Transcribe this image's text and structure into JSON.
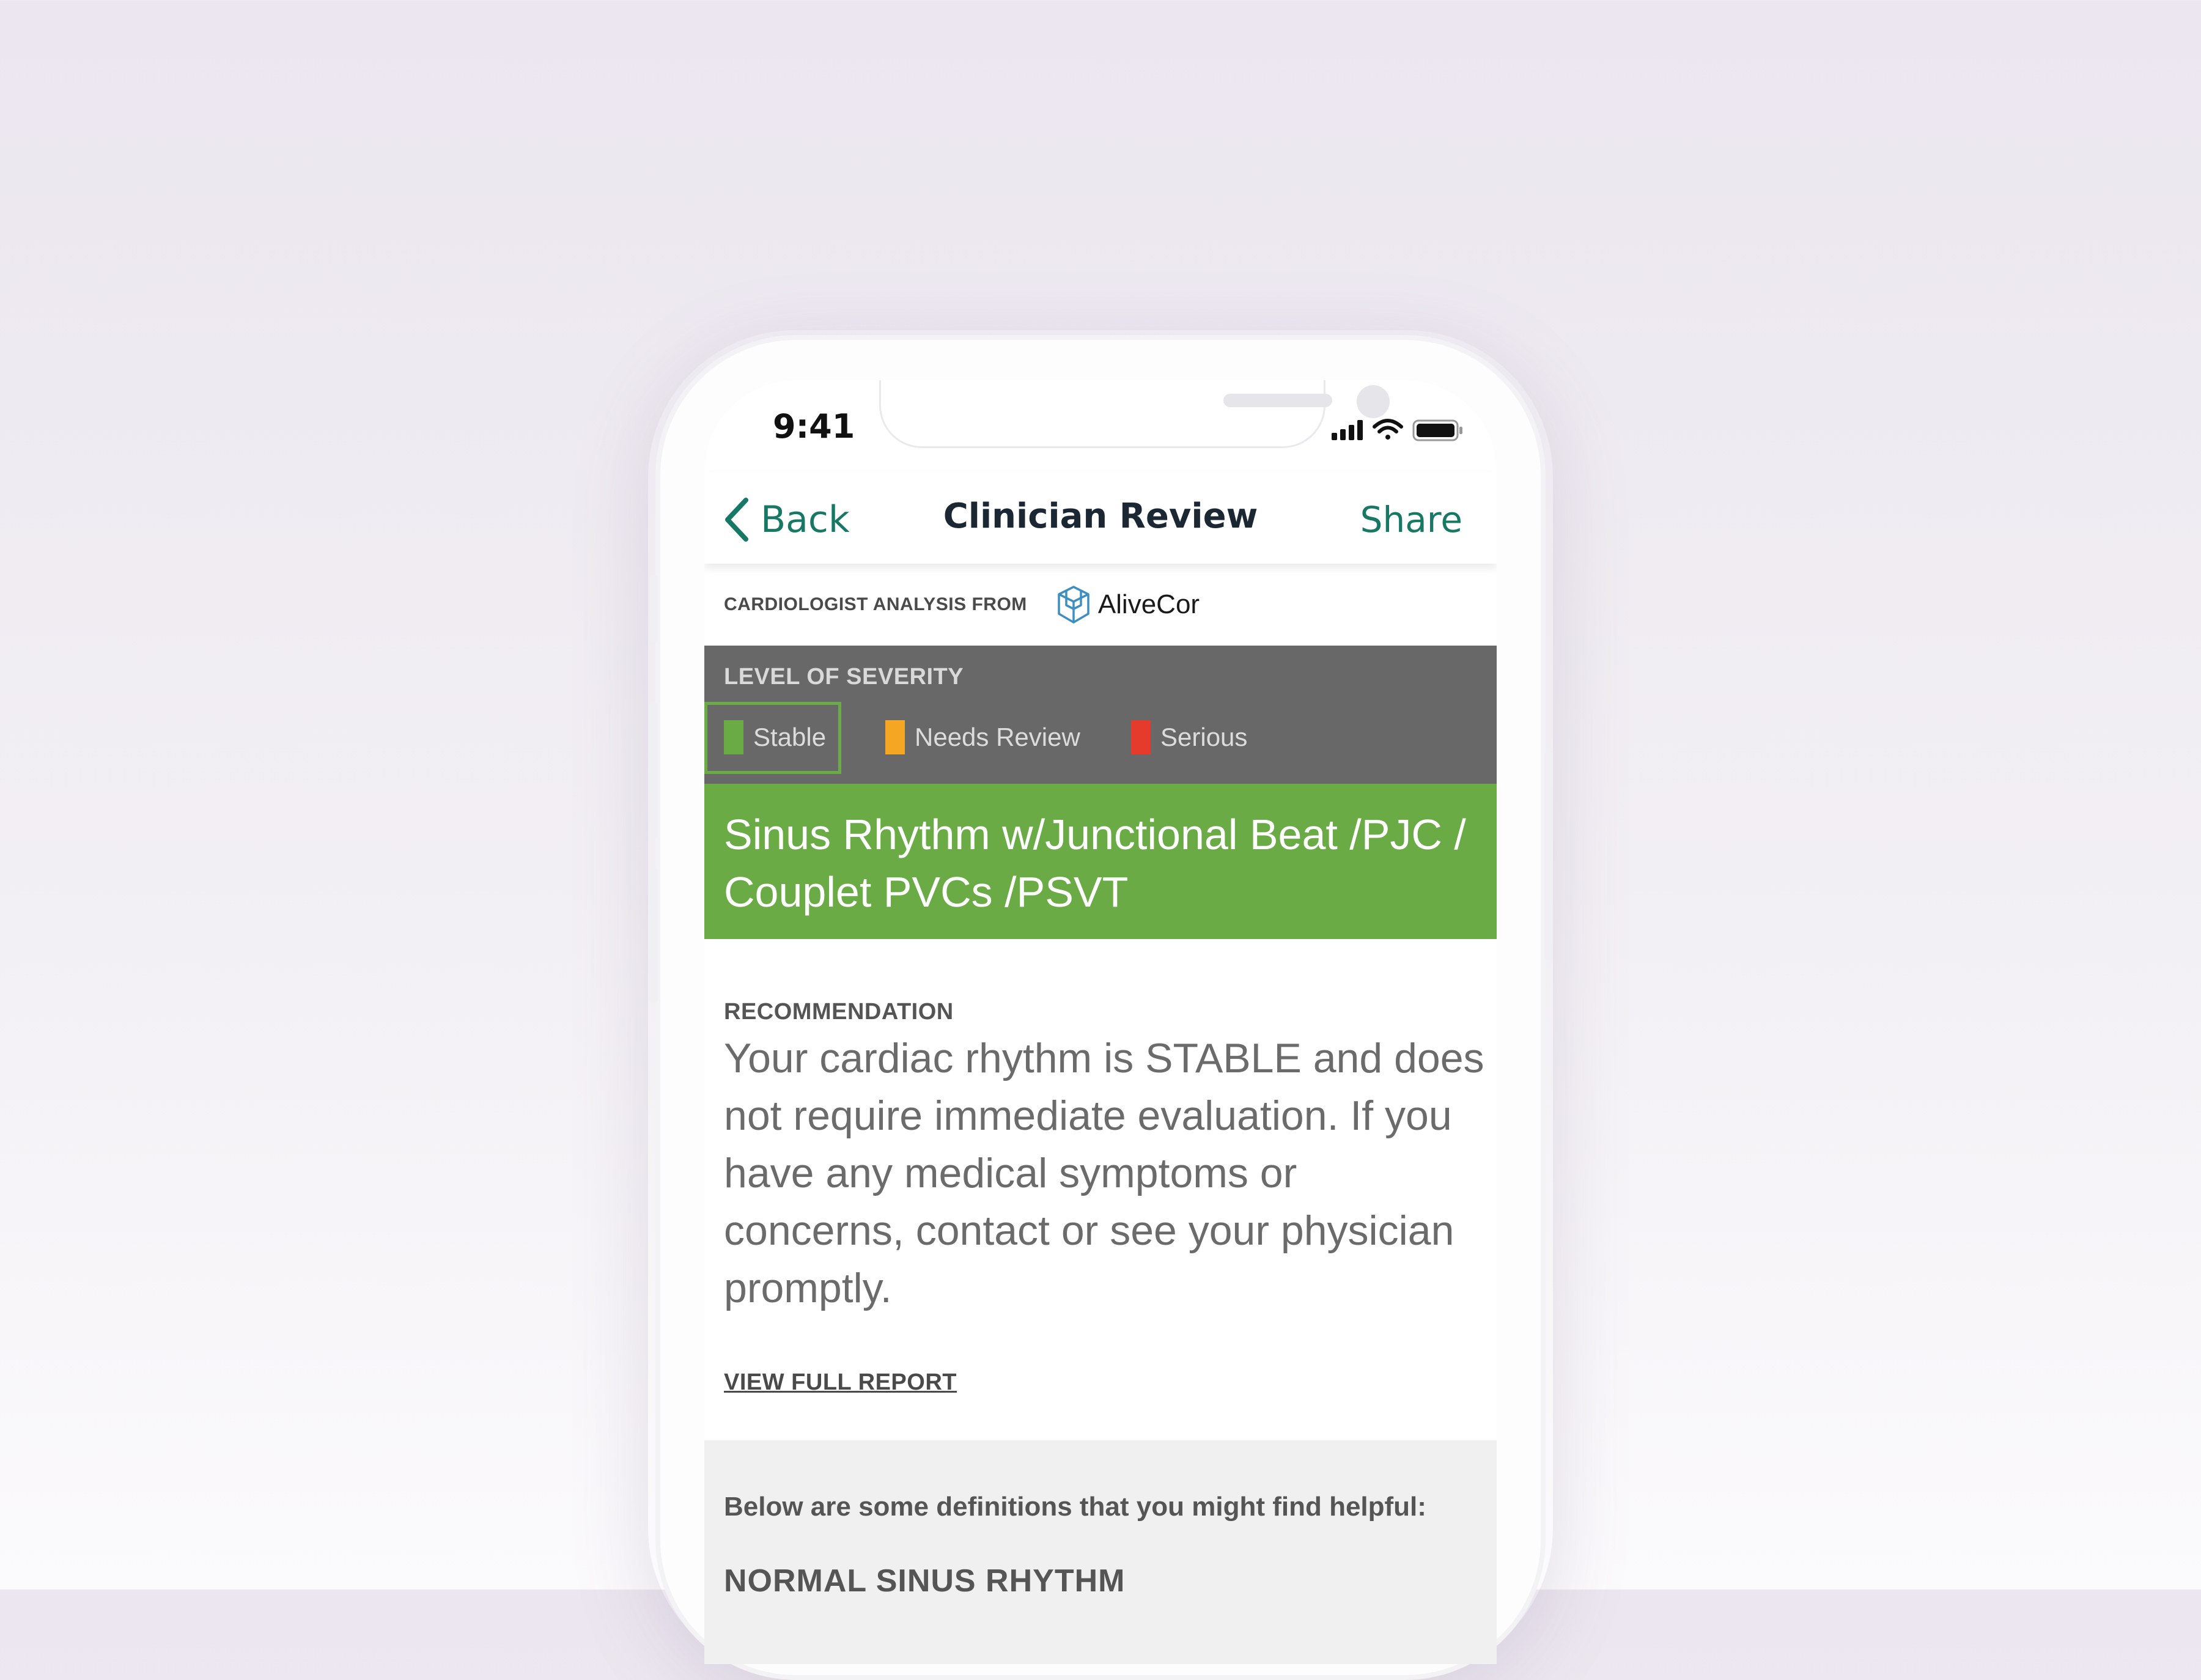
{
  "status_bar": {
    "time": "9:41"
  },
  "nav": {
    "back_label": "Back",
    "title": "Clinician Review",
    "share_label": "Share"
  },
  "source": {
    "label": "CARDIOLOGIST ANALYSIS FROM",
    "brand": "AliveCor"
  },
  "severity": {
    "heading": "LEVEL OF SEVERITY",
    "selected": "Stable",
    "levels": [
      {
        "label": "Stable",
        "color": "#6aab46"
      },
      {
        "label": "Needs Review",
        "color": "#f5a623"
      },
      {
        "label": "Serious",
        "color": "#e53b2c"
      }
    ]
  },
  "diagnosis": {
    "text": "Sinus Rhythm w/Junctional Beat /PJC / Couplet PVCs /PSVT",
    "color": "#6aab46"
  },
  "recommendation": {
    "heading": "RECOMMENDATION",
    "body": "Your cardiac rhythm is STABLE and does not require immediate evaluation.  If you have any medical symptoms or concerns, contact or see your physician promptly.",
    "link": "VIEW FULL REPORT"
  },
  "definitions": {
    "intro": "Below are some definitions that you might find helpful:",
    "first_term": "NORMAL SINUS RHYTHM"
  },
  "colors": {
    "accent": "#177865",
    "severity_bg": "#686868"
  }
}
